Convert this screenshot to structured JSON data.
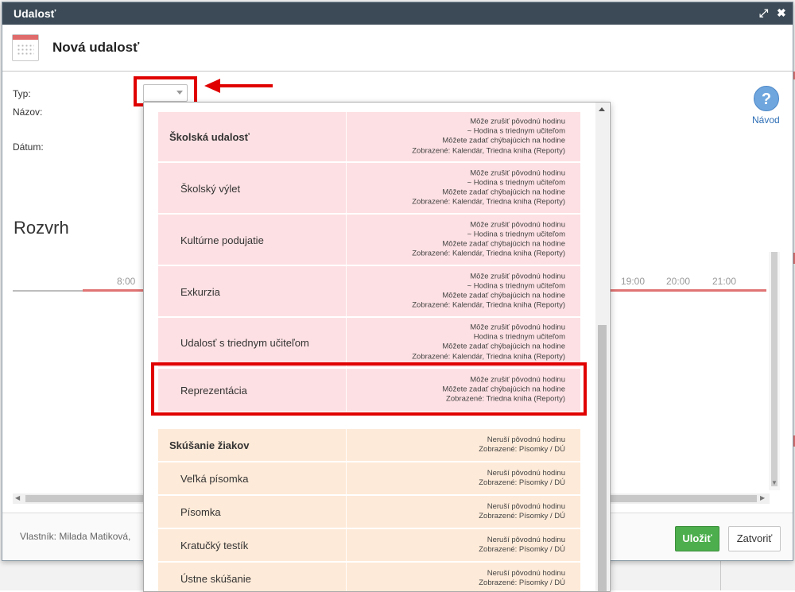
{
  "window": {
    "title": "Udalosť"
  },
  "header": {
    "title": "Nová udalosť"
  },
  "form": {
    "type_label": "Typ:",
    "name_label": "Názov:",
    "date_label": "Dátum:",
    "type_value": ""
  },
  "help": {
    "label": "Návod",
    "icon_glyph": "?"
  },
  "schedule": {
    "title": "Rozvrh",
    "hours": [
      "8:00",
      "19:00",
      "20:00",
      "21:00"
    ]
  },
  "footer": {
    "owner": "Vlastník: Milada Matiková,",
    "save_label": "Uložiť",
    "close_label": "Zatvoriť"
  },
  "dropdown": {
    "groups": [
      {
        "color": "pink",
        "items": [
          {
            "label": "Školská udalosť",
            "header": true,
            "height": 64,
            "desc": [
              "Môže zrušiť pôvodnú hodinu",
              "~ Hodina s triednym učiteľom",
              "Môžete zadať chýbajúcich na hodine",
              "Zobrazené: Kalendár, Triedna kniha (Reporty)"
            ]
          },
          {
            "label": "Školský výlet",
            "height": 65,
            "desc": [
              "Môže zrušiť pôvodnú hodinu",
              "~ Hodina s triednym učiteľom",
              "Môžete zadať chýbajúcich na hodine",
              "Zobrazené: Kalendár, Triedna kniha (Reporty)"
            ]
          },
          {
            "label": "Kultúrne podujatie",
            "height": 65,
            "desc": [
              "Môže zrušiť pôvodnú hodinu",
              "~ Hodina s triednym učiteľom",
              "Môžete zadať chýbajúcich na hodine",
              "Zobrazené: Kalendár, Triedna kniha (Reporty)"
            ]
          },
          {
            "label": "Exkurzia",
            "height": 65,
            "desc": [
              "Môže zrušiť pôvodnú hodinu",
              "~ Hodina s triednym učiteľom",
              "Môžete zadať chýbajúcich na hodine",
              "Zobrazené: Kalendár, Triedna kniha (Reporty)"
            ]
          },
          {
            "label": "Udalosť s triednym učiteľom",
            "height": 64,
            "desc": [
              "Môže zrušiť pôvodnú hodinu",
              "Hodina s triednym učiteľom",
              "Môžete zadať chýbajúcich na hodine",
              "Zobrazené: Kalendár, Triedna kniha (Reporty)"
            ]
          },
          {
            "label": "Reprezentácia",
            "height": 56,
            "desc": [
              "Môže zrušiť pôvodnú hodinu",
              "Môžete zadať chýbajúcich na hodine",
              "Zobrazené: Triedna kniha (Reporty)"
            ]
          }
        ]
      },
      {
        "color": "peach",
        "items": [
          {
            "label": "Skúšanie žiakov",
            "header": true,
            "height": 42,
            "desc": [
              "Neruší pôvodnú hodinu",
              "Zobrazené: Písomky / DÚ"
            ]
          },
          {
            "label": "Veľká písomka",
            "height": 42,
            "desc": [
              "Neruší pôvodnú hodinu",
              "Zobrazené: Písomky / DÚ"
            ]
          },
          {
            "label": "Písomka",
            "height": 42,
            "desc": [
              "Neruší pôvodnú hodinu",
              "Zobrazené: Písomky / DÚ"
            ]
          },
          {
            "label": "Kratučký testík",
            "height": 42,
            "desc": [
              "Neruší pôvodnú hodinu",
              "Zobrazené: Písomky / DÚ"
            ]
          },
          {
            "label": "Ústne skúšanie",
            "height": 42,
            "desc": [
              "Neruší pôvodnú hodinu",
              "Zobrazené: Písomky / DÚ"
            ]
          }
        ]
      }
    ]
  },
  "colors": {
    "accent_red": "#e00000",
    "save_green": "#4cae4c",
    "titlebar": "#3b4a56",
    "pink_row": "#fde0e3",
    "peach_row": "#feead8"
  }
}
